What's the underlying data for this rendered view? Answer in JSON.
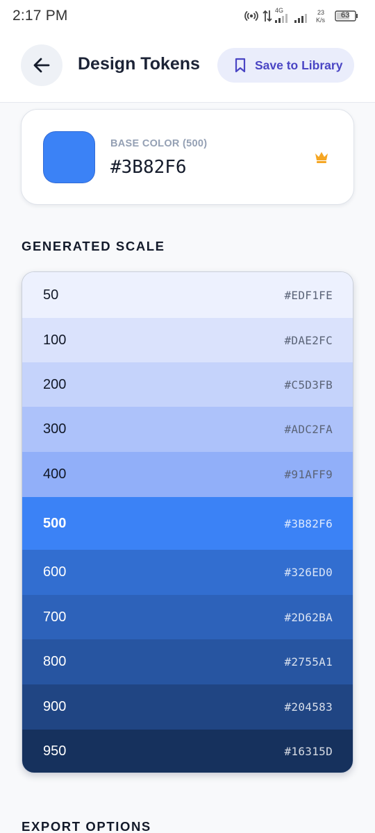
{
  "status_bar": {
    "time": "2:17 PM",
    "network_type": "4G",
    "speed_value": "23",
    "speed_unit": "K/s",
    "battery": "63"
  },
  "header": {
    "title": "Design Tokens",
    "back_icon": "arrow-left-icon",
    "save_icon": "bookmark-icon",
    "save_label": "Save to Library"
  },
  "base_color": {
    "label": "BASE COLOR (500)",
    "hex": "#3B82F6",
    "badge_icon": "crown-icon",
    "badge_color": "#F5A623"
  },
  "generated_scale": {
    "heading": "GENERATED SCALE",
    "items": [
      {
        "step": "50",
        "hex": "#EDF1FE"
      },
      {
        "step": "100",
        "hex": "#DAE2FC"
      },
      {
        "step": "200",
        "hex": "#C5D3FB"
      },
      {
        "step": "300",
        "hex": "#ADC2FA"
      },
      {
        "step": "400",
        "hex": "#91AFF9"
      },
      {
        "step": "500",
        "hex": "#3B82F6"
      },
      {
        "step": "600",
        "hex": "#326ED0"
      },
      {
        "step": "700",
        "hex": "#2D62BA"
      },
      {
        "step": "800",
        "hex": "#2755A1"
      },
      {
        "step": "900",
        "hex": "#204583"
      },
      {
        "step": "950",
        "hex": "#16315D"
      }
    ]
  },
  "export": {
    "heading": "EXPORT OPTIONS"
  },
  "colors": {
    "accent": "#4A45C4",
    "accent_bg": "#EAEDFB",
    "text_primary": "#1C2336",
    "text_muted": "#94A0B4"
  }
}
